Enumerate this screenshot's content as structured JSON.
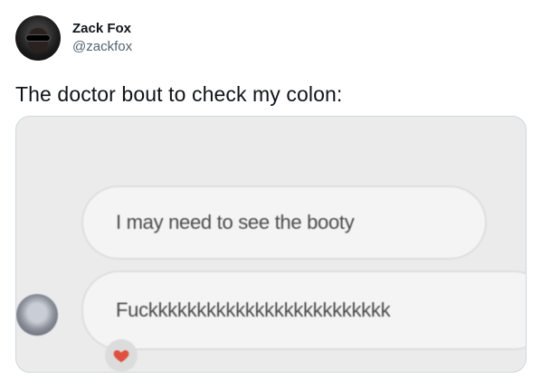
{
  "author": {
    "display_name": "Zack Fox",
    "handle": "@zackfox"
  },
  "tweet": {
    "text": "The doctor bout to check my colon:"
  },
  "media": {
    "messages": [
      {
        "text": "I may need to see the booty"
      },
      {
        "text": "Fuckkkkkkkkkkkkkkkkkkkkkkkkk"
      }
    ],
    "reaction_icon": "heart-icon",
    "reaction_color": "#e0503f"
  }
}
